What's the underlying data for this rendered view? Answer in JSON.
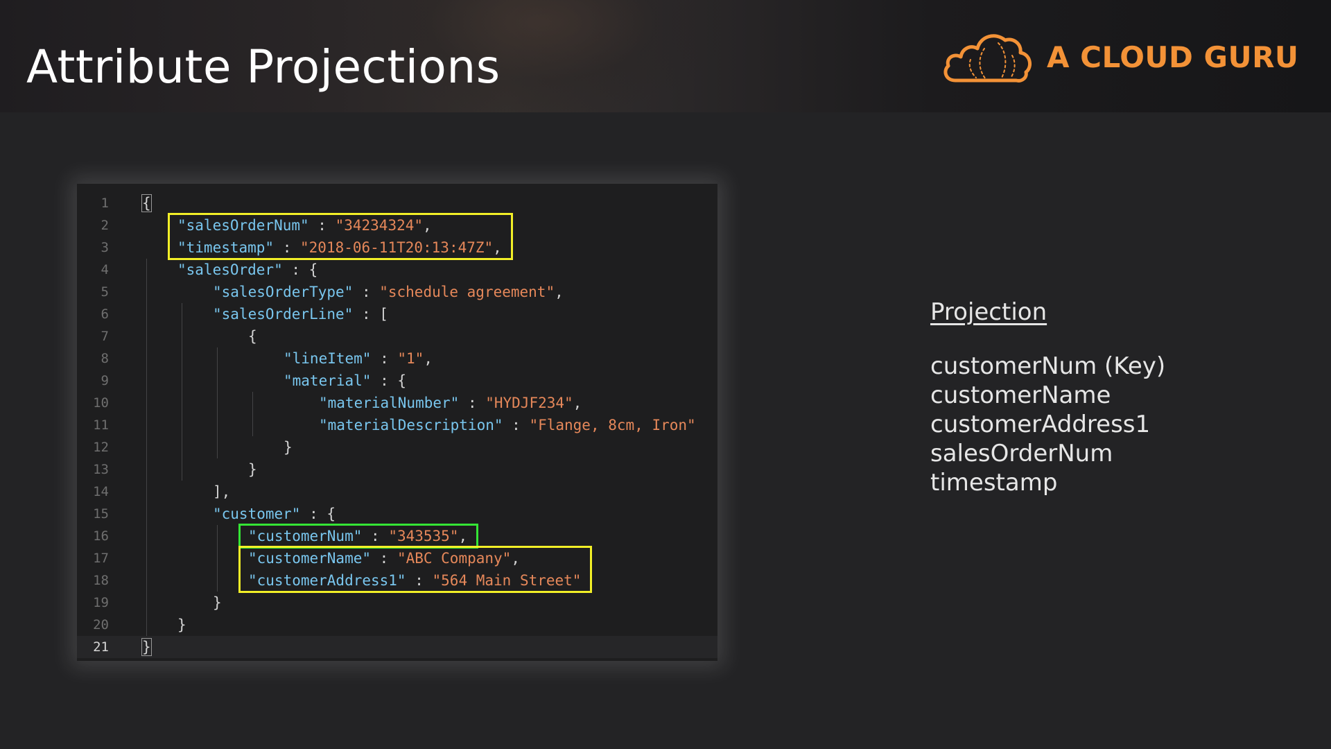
{
  "slide": {
    "title": "Attribute Projections"
  },
  "logo": {
    "icon": "cloud-icon",
    "text": "A CLOUD GURU",
    "color": "#f39237"
  },
  "code_editor": {
    "language": "json",
    "lines": [
      {
        "num": "1",
        "indent": 0,
        "tokens": [
          {
            "t": "{",
            "c": "p",
            "box": true
          }
        ]
      },
      {
        "num": "2",
        "indent": 1,
        "tokens": [
          {
            "t": "\"salesOrderNum\"",
            "c": "k"
          },
          {
            "t": " : ",
            "c": "p"
          },
          {
            "t": "\"34234324\"",
            "c": "s"
          },
          {
            "t": ",",
            "c": "p"
          }
        ]
      },
      {
        "num": "3",
        "indent": 1,
        "tokens": [
          {
            "t": "\"timestamp\"",
            "c": "k"
          },
          {
            "t": " : ",
            "c": "p"
          },
          {
            "t": "\"2018-06-11T20:13:47Z\"",
            "c": "s"
          },
          {
            "t": ",",
            "c": "p"
          }
        ]
      },
      {
        "num": "4",
        "indent": 1,
        "tokens": [
          {
            "t": "\"salesOrder\"",
            "c": "k"
          },
          {
            "t": " : {",
            "c": "p"
          }
        ]
      },
      {
        "num": "5",
        "indent": 2,
        "tokens": [
          {
            "t": "\"salesOrderType\"",
            "c": "k"
          },
          {
            "t": " : ",
            "c": "p"
          },
          {
            "t": "\"schedule agreement\"",
            "c": "s"
          },
          {
            "t": ",",
            "c": "p"
          }
        ]
      },
      {
        "num": "6",
        "indent": 2,
        "tokens": [
          {
            "t": "\"salesOrderLine\"",
            "c": "k"
          },
          {
            "t": " : [",
            "c": "p"
          }
        ]
      },
      {
        "num": "7",
        "indent": 3,
        "tokens": [
          {
            "t": "{",
            "c": "p"
          }
        ]
      },
      {
        "num": "8",
        "indent": 4,
        "tokens": [
          {
            "t": "\"lineItem\"",
            "c": "k"
          },
          {
            "t": " : ",
            "c": "p"
          },
          {
            "t": "\"1\"",
            "c": "s"
          },
          {
            "t": ",",
            "c": "p"
          }
        ]
      },
      {
        "num": "9",
        "indent": 4,
        "tokens": [
          {
            "t": "\"material\"",
            "c": "k"
          },
          {
            "t": " : {",
            "c": "p"
          }
        ]
      },
      {
        "num": "10",
        "indent": 5,
        "tokens": [
          {
            "t": "\"materialNumber\"",
            "c": "k"
          },
          {
            "t": " : ",
            "c": "p"
          },
          {
            "t": "\"HYDJF234\"",
            "c": "s"
          },
          {
            "t": ",",
            "c": "p"
          }
        ]
      },
      {
        "num": "11",
        "indent": 5,
        "tokens": [
          {
            "t": "\"materialDescription\"",
            "c": "k"
          },
          {
            "t": " : ",
            "c": "p"
          },
          {
            "t": "\"Flange, 8cm, Iron\"",
            "c": "s"
          }
        ]
      },
      {
        "num": "12",
        "indent": 4,
        "tokens": [
          {
            "t": "}",
            "c": "p"
          }
        ]
      },
      {
        "num": "13",
        "indent": 3,
        "tokens": [
          {
            "t": "}",
            "c": "p"
          }
        ]
      },
      {
        "num": "14",
        "indent": 2,
        "tokens": [
          {
            "t": "],",
            "c": "p"
          }
        ]
      },
      {
        "num": "15",
        "indent": 2,
        "tokens": [
          {
            "t": "\"customer\"",
            "c": "k"
          },
          {
            "t": " : {",
            "c": "p"
          }
        ]
      },
      {
        "num": "16",
        "indent": 3,
        "tokens": [
          {
            "t": "\"customerNum\"",
            "c": "k"
          },
          {
            "t": " : ",
            "c": "p"
          },
          {
            "t": "\"343535\"",
            "c": "s"
          },
          {
            "t": ",",
            "c": "p"
          }
        ]
      },
      {
        "num": "17",
        "indent": 3,
        "tokens": [
          {
            "t": "\"customerName\"",
            "c": "k"
          },
          {
            "t": " : ",
            "c": "p"
          },
          {
            "t": "\"ABC Company\"",
            "c": "s"
          },
          {
            "t": ",",
            "c": "p"
          }
        ]
      },
      {
        "num": "18",
        "indent": 3,
        "tokens": [
          {
            "t": "\"customerAddress1\"",
            "c": "k"
          },
          {
            "t": " : ",
            "c": "p"
          },
          {
            "t": "\"564 Main Street\"",
            "c": "s"
          }
        ]
      },
      {
        "num": "19",
        "indent": 2,
        "tokens": [
          {
            "t": "}",
            "c": "p"
          }
        ]
      },
      {
        "num": "20",
        "indent": 1,
        "tokens": [
          {
            "t": "}",
            "c": "p"
          }
        ]
      },
      {
        "num": "21",
        "indent": 0,
        "active": true,
        "tokens": [
          {
            "t": "}",
            "c": "p",
            "box": true
          }
        ]
      }
    ],
    "highlights": [
      {
        "name": "highlight-salesorder-attributes",
        "color": "yellow",
        "from_line": 2,
        "to_line": 3
      },
      {
        "name": "highlight-customer-key",
        "color": "green",
        "from_line": 16,
        "to_line": 16
      },
      {
        "name": "highlight-customer-attributes",
        "color": "yellow",
        "from_line": 17,
        "to_line": 18
      }
    ],
    "colors": {
      "key": "#79c6ee",
      "string": "#e6885a",
      "punct": "#d4d4d4",
      "highlight_yellow": "#f2ef27",
      "highlight_green": "#35e535"
    }
  },
  "projection": {
    "heading": "Projection",
    "items": [
      "customerNum (Key)",
      "customerName",
      "customerAddress1",
      "salesOrderNum",
      "timestamp"
    ]
  }
}
